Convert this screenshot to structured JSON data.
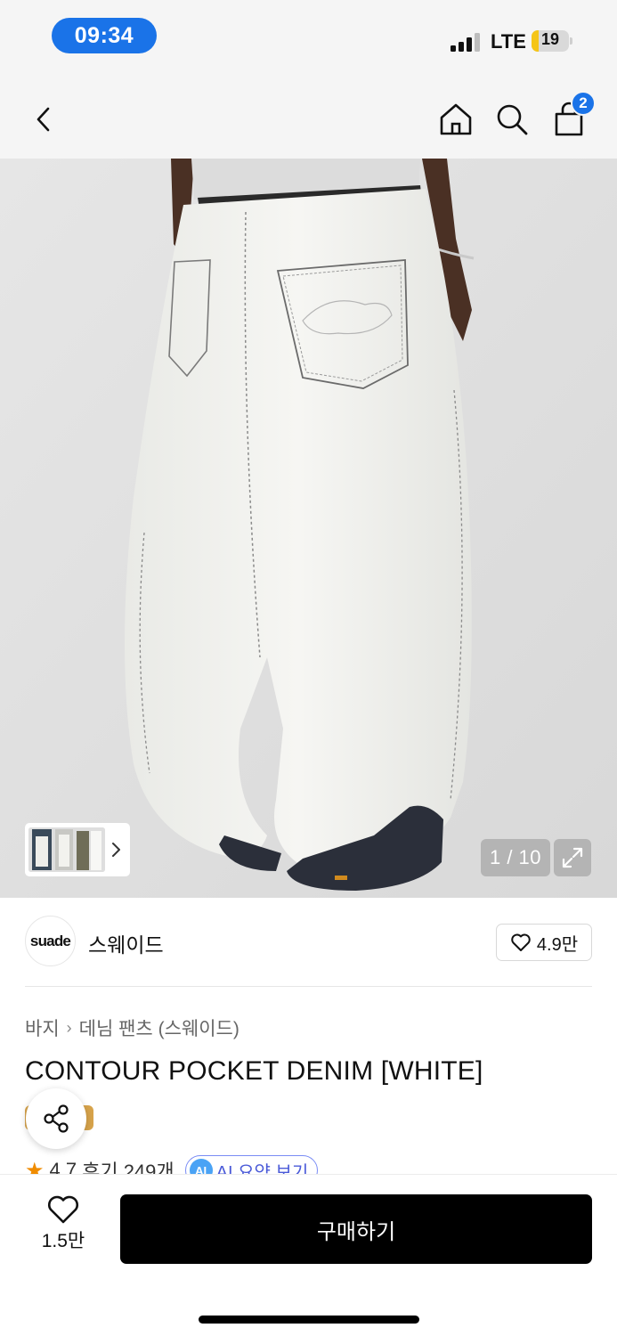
{
  "status_bar": {
    "time": "09:34",
    "network": "LTE",
    "battery": "19",
    "battery_level": 0.19,
    "signal_bars": 3,
    "signal_bars_total": 4
  },
  "top_nav": {
    "back_icon": "chevron-left-icon",
    "home_icon": "home-icon",
    "search_icon": "search-icon",
    "bag_icon": "shopping-bag-icon",
    "cart_count": "2"
  },
  "gallery": {
    "counter": "1 / 10",
    "expand_icon": "expand-icon",
    "thumbnail_arrow_icon": "chevron-right-icon"
  },
  "brand": {
    "logo_text": "suade",
    "name": "스웨이드",
    "like_count": "4.9만"
  },
  "product": {
    "breadcrumb": [
      "바지",
      "데님 팬츠 (스웨이드)"
    ],
    "title": "CONTOUR POCKET DENIM [WHITE]",
    "rating": "4.7",
    "reviews": "후기 249개",
    "ai_label": "AI",
    "ai_summary": "AI 요약 보기"
  },
  "bottom_bar": {
    "wish_count": "1.5만",
    "buy_label": "구매하기"
  },
  "colors": {
    "accent_blue": "#1a73e8",
    "buy_button": "#000000",
    "rating_star": "#f08c00",
    "tag": "#d7a34b"
  }
}
